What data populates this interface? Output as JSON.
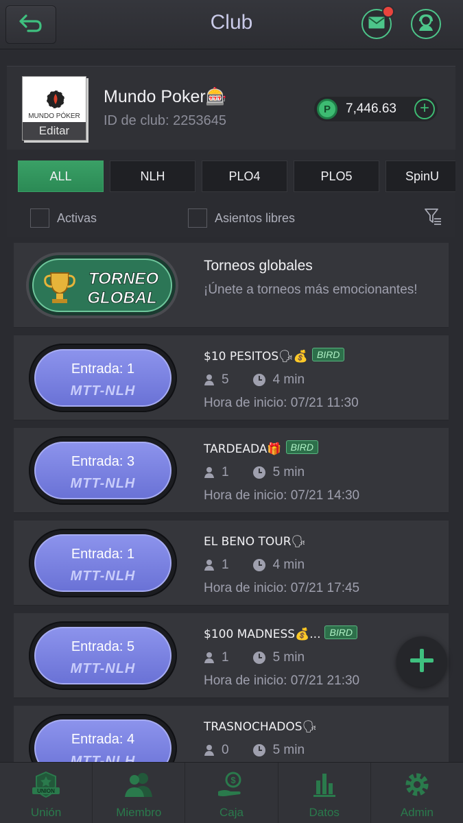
{
  "header": {
    "title": "Club"
  },
  "club": {
    "name": "Mundo Poker🎰",
    "id_text": "ID de club: 2253645",
    "logo_text": "MUNDO PÓKER",
    "edit_label": "Editar",
    "balance": "7,446.63",
    "coin_symbol": "P"
  },
  "filters": {
    "tabs": [
      "ALL",
      "NLH",
      "PLO4",
      "PLO5",
      "SpinU"
    ],
    "active_tab": "ALL",
    "checkbox_active": "Activas",
    "checkbox_seats": "Asientos libres"
  },
  "global_tournament": {
    "badge_line1": "TORNEO",
    "badge_line2": "GLOBAL",
    "title": "Torneos globales",
    "subtitle": "¡Únete a torneos más emocionantes!"
  },
  "tournaments": [
    {
      "entry": "Entrada: 1",
      "type": "MTT-NLH",
      "name": "$10 PESITOS🗣💰",
      "bird": "BIRD",
      "players": "5",
      "duration": "4 min",
      "start": "Hora de inicio: 07/21 11:30"
    },
    {
      "entry": "Entrada: 3",
      "type": "MTT-NLH",
      "name": "TARDEADA🎁",
      "bird": "BIRD",
      "players": "1",
      "duration": "5 min",
      "start": "Hora de inicio: 07/21 14:30"
    },
    {
      "entry": "Entrada: 1",
      "type": "MTT-NLH",
      "name": "EL BENO TOUR🗣",
      "bird": "",
      "players": "1",
      "duration": "4 min",
      "start": "Hora de inicio: 07/21 17:45"
    },
    {
      "entry": "Entrada: 5",
      "type": "MTT-NLH",
      "name": "$100 MADNESS💰...",
      "bird": "BIRD",
      "players": "1",
      "duration": "5 min",
      "start": "Hora de inicio: 07/21 21:30"
    },
    {
      "entry": "Entrada: 4",
      "type": "MTT-NLH",
      "name": "TRASNOCHADOS🗣",
      "bird": "",
      "players": "0",
      "duration": "5 min",
      "start": ""
    }
  ],
  "bottom_nav": {
    "items": [
      "Unión",
      "Miembro",
      "Caja",
      "Datos",
      "Admin"
    ],
    "union_badge": "UNION"
  },
  "colors": {
    "accent_green": "#3aa066",
    "entry_purple": "#7c83e4",
    "notification_red": "#e8443d"
  },
  "icons": {
    "back": "back-arrow-icon",
    "mail": "mail-icon",
    "support": "support-agent-icon",
    "filter": "filter-icon",
    "players": "person-icon",
    "clock": "clock-icon",
    "fab": "plus-icon"
  }
}
